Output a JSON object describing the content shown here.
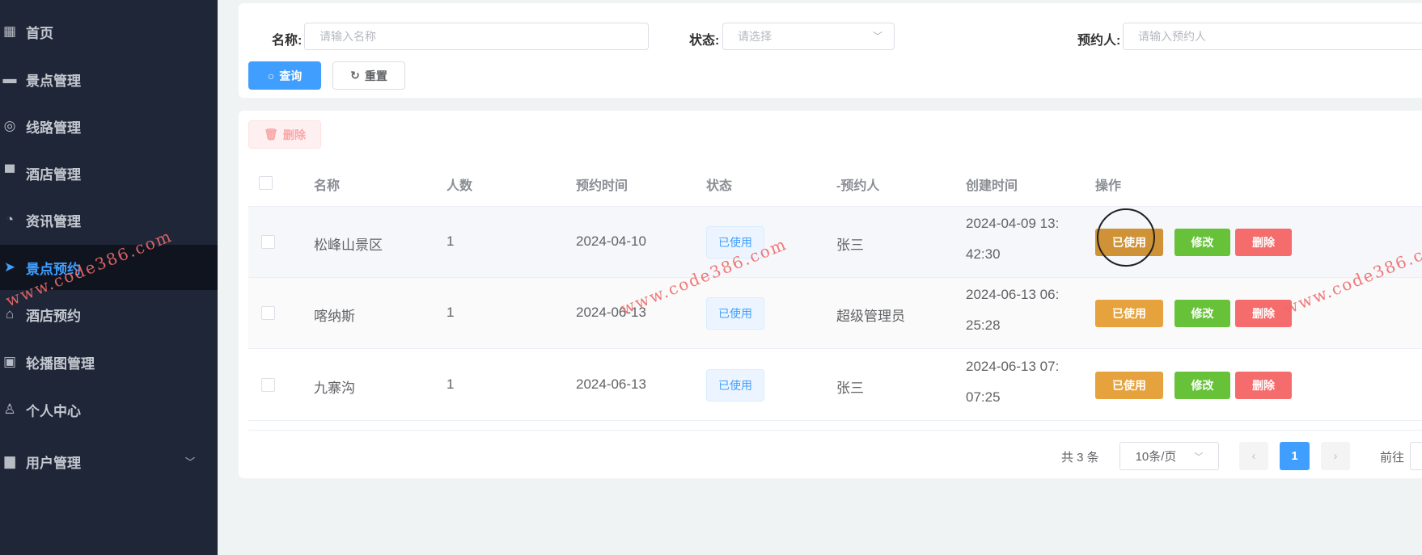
{
  "sidebar": {
    "items": [
      {
        "label": "首页",
        "icon": "grid-icon"
      },
      {
        "label": "景点管理",
        "icon": "ticket-icon"
      },
      {
        "label": "线路管理",
        "icon": "lifebuoy-icon"
      },
      {
        "label": "酒店管理",
        "icon": "shop-icon"
      },
      {
        "label": "资讯管理",
        "icon": "chart-icon"
      },
      {
        "label": "景点预约",
        "icon": "send-icon",
        "active": true
      },
      {
        "label": "酒店预约",
        "icon": "house-icon"
      },
      {
        "label": "轮播图管理",
        "icon": "image-icon"
      },
      {
        "label": "个人中心",
        "icon": "user-icon"
      },
      {
        "label": "用户管理",
        "icon": "monitor-icon"
      }
    ]
  },
  "search": {
    "name_label": "名称:",
    "name_placeholder": "请输入名称",
    "status_label": "状态:",
    "status_placeholder": "请选择",
    "person_label": "预约人:",
    "person_placeholder": "请输入预约人",
    "query_label": "查询",
    "reset_label": "重置"
  },
  "toolbar": {
    "delete_label": "删除"
  },
  "table": {
    "headers": [
      "名称",
      "人数",
      "预约时间",
      "状态",
      "-预约人",
      "创建时间",
      "操作"
    ],
    "rows": [
      {
        "name": "松峰山景区",
        "count": "1",
        "date": "2024-04-10",
        "status": "已使用",
        "person": "张三",
        "created1": "2024-04-09 13:",
        "created2": "42:30"
      },
      {
        "name": "喀纳斯",
        "count": "1",
        "date": "2024-06-13",
        "status": "已使用",
        "person": "超级管理员",
        "created1": "2024-06-13 06:",
        "created2": "25:28"
      },
      {
        "name": "九寨沟",
        "count": "1",
        "date": "2024-06-13",
        "status": "已使用",
        "person": "张三",
        "created1": "2024-06-13 07:",
        "created2": "07:25"
      }
    ],
    "actions": {
      "use": "已使用",
      "edit": "修改",
      "delete": "删除"
    }
  },
  "pagination": {
    "total": "共 3 条",
    "page_size": "10条/页",
    "current_page": "1",
    "goto_label": "前往"
  },
  "watermark": "www.code386.com",
  "colors": {
    "sidebar": "#1f2638",
    "primary": "#409eff",
    "warning": "#e6a23c",
    "success": "#67c23a",
    "danger": "#f56c6c"
  }
}
